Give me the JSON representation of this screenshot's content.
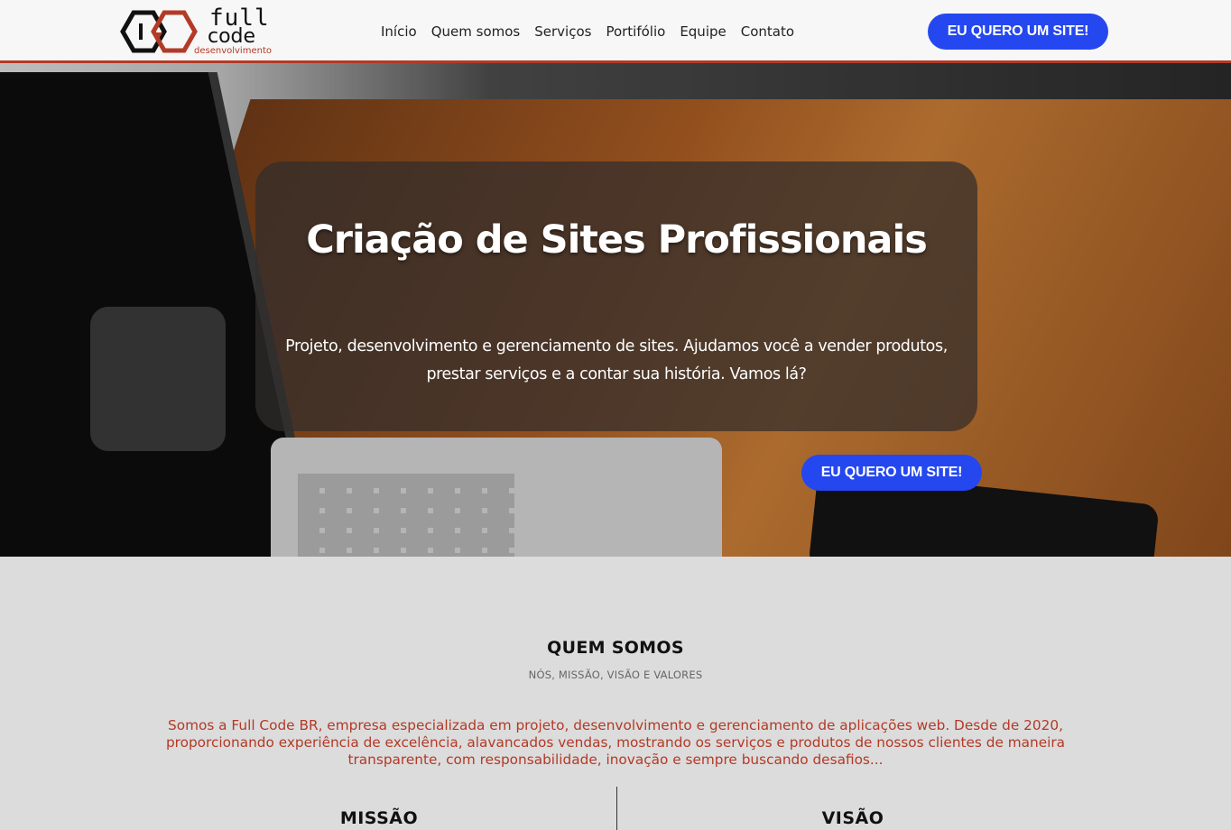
{
  "logo": {
    "word1": "full",
    "word2": "code",
    "word3": "desenvolvimento"
  },
  "nav": {
    "items": [
      "Início",
      "Quem somos",
      "Serviços",
      "Portifólio",
      "Equipe",
      "Contato"
    ]
  },
  "header": {
    "cta_label": "EU QUERO UM SITE!"
  },
  "hero": {
    "title": "Criação de Sites Profissionais",
    "text": "Projeto, desenvolvimento e gerenciamento de sites. Ajudamos você a vender produtos, prestar serviços e a contar sua história. Vamos lá?",
    "cta_label": "EU QUERO UM SITE!"
  },
  "about": {
    "title": "QUEM SOMOS",
    "subtitle": "NÓS, MISSÃO, VISÃO E VALORES",
    "text": "Somos a Full Code BR, empresa especializada em projeto, desenvolvimento e gerenciamento de aplicações web. Desde de 2020, proporcionando experiência de excelência, alavancados vendas, mostrando os serviços e produtos de nossos clientes de maneira transparente, com responsabilidade, inovação e sempre buscando desafios...",
    "col1": "MISSÃO",
    "col2": "VISÃO"
  },
  "colors": {
    "accent": "#2447f0",
    "brand": "#b33a26"
  }
}
